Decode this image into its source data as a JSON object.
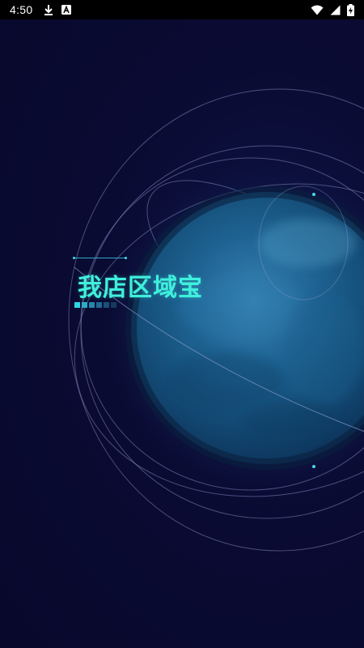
{
  "status_bar": {
    "time": "4:50",
    "left_icons": [
      "download-icon",
      "font-a-icon"
    ],
    "right_icons": [
      "wifi-icon",
      "signal-icon",
      "battery-charging-icon"
    ]
  },
  "splash": {
    "app_name": "我店区域宝",
    "accent_color": "#3ff0dc",
    "background_color": "#0a0a30",
    "planet_color": "#1a5a86",
    "decorative_icons": [
      "planet-graphic",
      "orbit-lines",
      "progress-squares"
    ]
  }
}
